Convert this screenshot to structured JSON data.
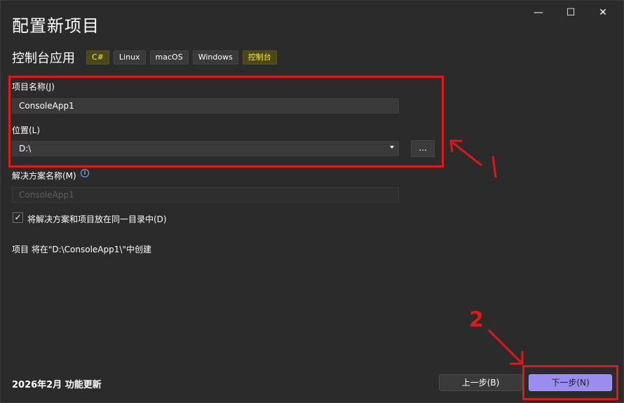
{
  "window": {
    "title": "配置新项目",
    "minimize_glyph": "—",
    "maximize_glyph": "☐",
    "close_glyph": "✕"
  },
  "project_type": {
    "title": "控制台应用",
    "tags": [
      "C#",
      "Linux",
      "macOS",
      "Windows",
      "控制台"
    ],
    "highlight_color": "#f4e84a"
  },
  "form": {
    "project_name_label": "项目名称(J)",
    "project_name_value": "ConsoleApp1",
    "location_label": "位置(L)",
    "location_value": "D:\\",
    "browse_label": "...",
    "solution_name_label": "解决方案名称(M)",
    "solution_name_value": "ConsoleApp1",
    "info_icon": "info-icon",
    "same_dir_checked": true,
    "same_dir_label": "将解决方案和项目放在同一目录中(D)",
    "creation_note": "项目 将在\"D:\\ConsoleApp1\\\"中创建"
  },
  "annotations": {
    "step1": "1",
    "step2": "2",
    "color": "#e01818"
  },
  "footer": {
    "update_text": "2026年2月 功能更新",
    "prev_button": "上一步(B)",
    "next_button": "下一步(N)",
    "accent": "#9b8cf0"
  }
}
